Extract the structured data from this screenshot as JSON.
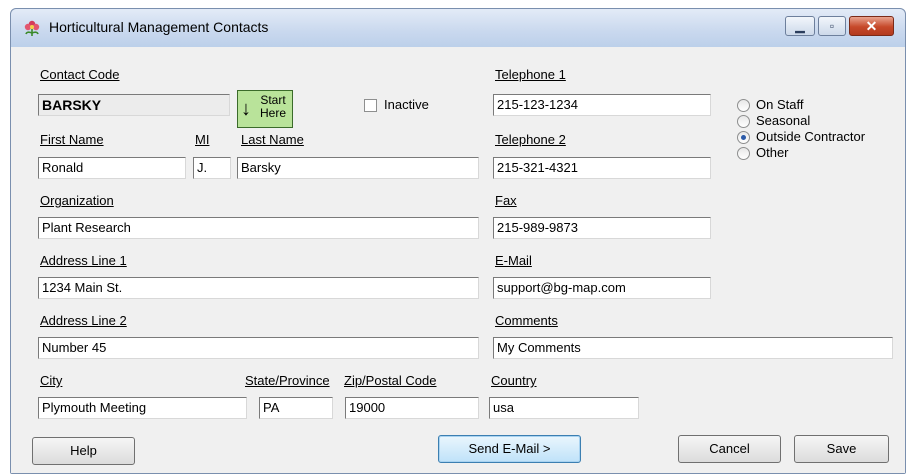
{
  "window": {
    "title": "Horticultural Management Contacts"
  },
  "form": {
    "contact_code": {
      "label": "Contact Code",
      "value": "BARSKY"
    },
    "start_here": {
      "line1": "Start",
      "line2": "Here",
      "arrow": "↓"
    },
    "inactive": {
      "label": "Inactive",
      "checked": false
    },
    "first_name": {
      "label": "First Name",
      "value": "Ronald"
    },
    "mi": {
      "label": "MI",
      "value": "J."
    },
    "last_name": {
      "label": "Last Name",
      "value": "Barsky"
    },
    "organization": {
      "label": "Organization",
      "value": "Plant Research"
    },
    "address1": {
      "label": "Address Line 1",
      "value": "1234 Main St."
    },
    "address2": {
      "label": "Address Line 2",
      "value": "Number 45"
    },
    "city": {
      "label": "City",
      "value": "Plymouth Meeting"
    },
    "state": {
      "label": "State/Province",
      "value": "PA"
    },
    "zip": {
      "label": "Zip/Postal Code",
      "value": "19000"
    },
    "country": {
      "label": "Country",
      "value": "usa"
    },
    "telephone1": {
      "label": "Telephone 1",
      "value": "215-123-1234"
    },
    "telephone2": {
      "label": "Telephone 2",
      "value": "215-321-4321"
    },
    "fax": {
      "label": "Fax",
      "value": "215-989-9873"
    },
    "email": {
      "label": "E-Mail",
      "value": "support@bg-map.com"
    },
    "comments": {
      "label": "Comments",
      "value": "My Comments"
    }
  },
  "staff_type": {
    "options": [
      "On Staff",
      "Seasonal",
      "Outside Contractor",
      "Other"
    ],
    "selected": "Outside Contractor"
  },
  "buttons": {
    "help": "Help",
    "send_email": "Send E-Mail >",
    "cancel": "Cancel",
    "save": "Save"
  },
  "icons": {
    "app": "flower-icon",
    "minimize": "minimize-icon",
    "maximize": "maximize-icon",
    "close": "close-icon"
  }
}
